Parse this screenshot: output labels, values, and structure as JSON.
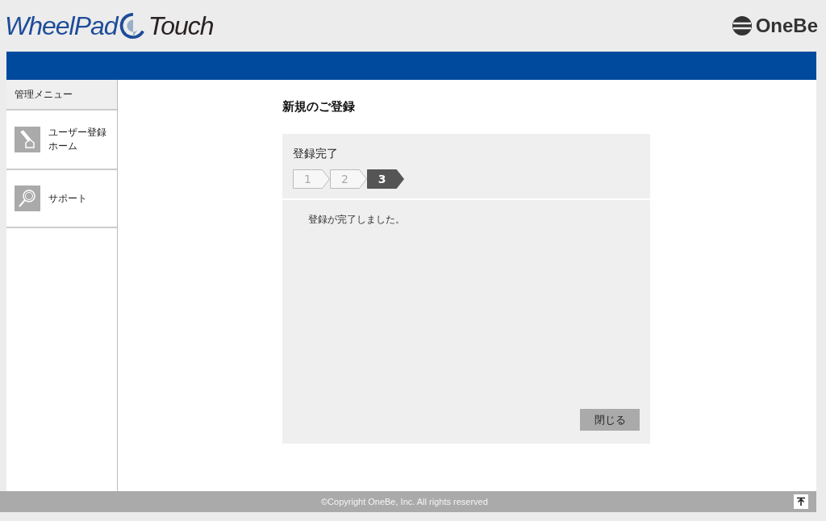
{
  "header": {
    "logo_left": {
      "part1": "WheelPad",
      "part2": "Touch"
    },
    "logo_right": "OneBe"
  },
  "sidebar": {
    "title": "管理メニュー",
    "items": [
      {
        "label": "ユーザー登録ホーム",
        "kind": "home"
      },
      {
        "label": "サポート",
        "kind": "support"
      }
    ]
  },
  "page_title": "新規のご登録",
  "panel": {
    "title": "登録完了",
    "steps": [
      {
        "label": "1",
        "selected": false
      },
      {
        "label": "2",
        "selected": false
      },
      {
        "label": "3",
        "selected": true
      }
    ],
    "message": "登録が完了しました。",
    "close_button": "閉じる"
  },
  "footer": {
    "copyright": "©Copyright OneBe, Inc. All rights reserved"
  }
}
